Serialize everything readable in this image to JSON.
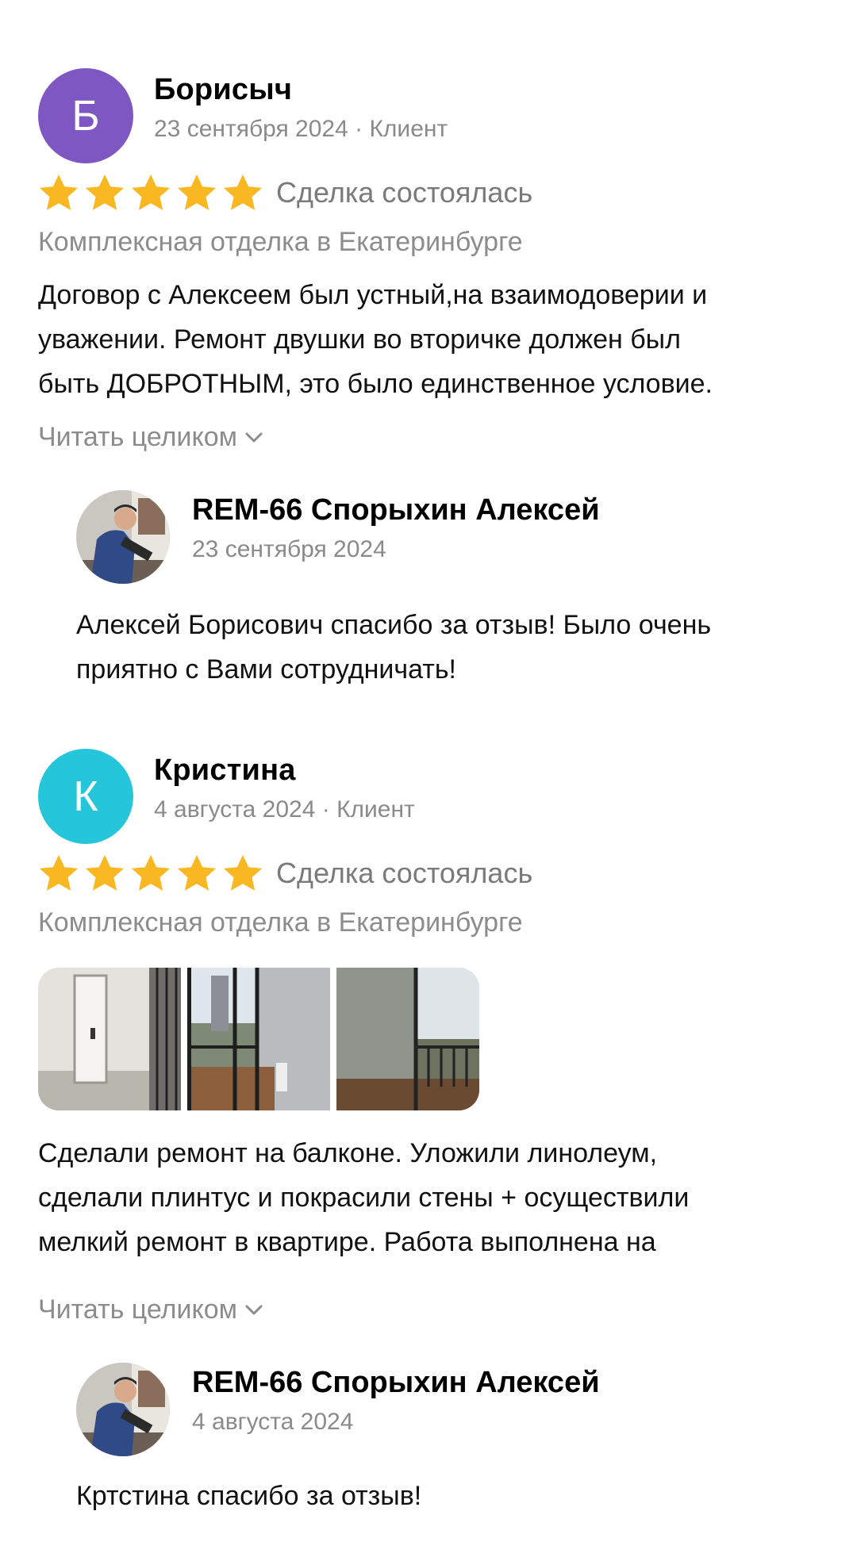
{
  "colors": {
    "avatar_b": "#7e57c2",
    "avatar_k": "#26c6da",
    "star": "#f9b722",
    "muted": "#8c8c8c"
  },
  "reviews": [
    {
      "initial": "Б",
      "author": "Борисыч",
      "meta": "23 сентября 2024 · Клиент",
      "rating": 5,
      "deal_status": "Сделка состоялась",
      "service": "Комплексная отделка в Екатеринбурге",
      "text_lines": [
        "Договор с Алексеем был устный,на взаимодоверии и",
        "уважении. Ремонт двушки во вторичке должен был",
        "быть ДОБРОТНЫМ, это было единственное условие."
      ],
      "read_more": "Читать целиком",
      "reply": {
        "author": "REM-66 Спорыхин Алексей",
        "date": "23 сентября 2024",
        "text_lines": [
          "Алексей Борисович спасибо за отзыв! Было очень",
          "приятно с Вами сотрудничать!"
        ]
      }
    },
    {
      "initial": "К",
      "author": "Кристина",
      "meta": "4 августа 2024 · Клиент",
      "rating": 5,
      "deal_status": "Сделка состоялась",
      "service": "Комплексная отделка в Екатеринбурге",
      "text_lines": [
        "Сделали ремонт на балконе. Уложили линолеум,",
        "сделали плинтус и покрасили стены + осуществили",
        "мелкий ремонт в квартире. Работа выполнена на"
      ],
      "read_more": "Читать целиком",
      "reply": {
        "author": "REM-66 Спорыхин Алексей",
        "date": "4 августа 2024",
        "text_lines": [
          "Кртстина спасибо за отзыв!"
        ]
      }
    }
  ]
}
